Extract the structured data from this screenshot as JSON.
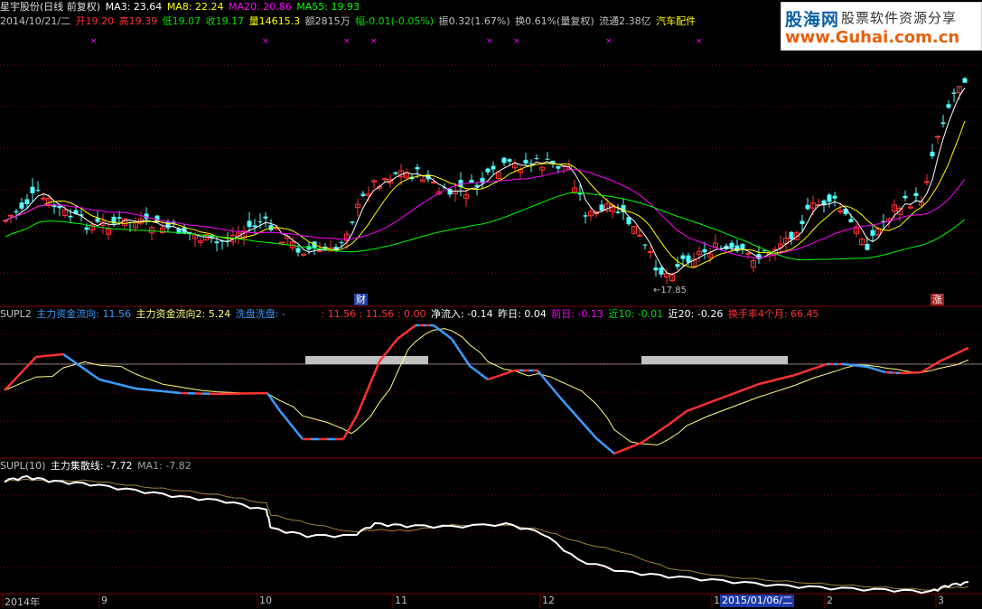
{
  "header": {
    "stock": "星宇股份(日线 前复权)",
    "ma3_label": "MA3: 23.64",
    "ma8_label": "MA8: 22.24",
    "ma20_label": "MA20: 20.86",
    "ma55_label": "MA55: 19.93",
    "date": "2014/10/21/二",
    "open": "开19.20",
    "high": "高19.39",
    "low": "低19.07",
    "close": "收19.17",
    "volume": "量14615.3",
    "amount": "额2815万",
    "change": "幅-0.01(-0.05%)",
    "amplitude": "振0.32(1.67%)",
    "turnover": "换0.61%(量复权)",
    "float": "流通2.38亿",
    "sector": "汽车配件"
  },
  "watermark": {
    "name": "股海网",
    "slogan": "股票软件资源分享",
    "url": "www.Guhai.com.cn"
  },
  "price_panel": {
    "low_label": "17.85",
    "badge_fin": "财",
    "badge_up": "涨"
  },
  "panel2": {
    "title": "SUPL2",
    "flow1": "主力资金流向: 11.56",
    "flow2": "主力资金流向2: 5.24",
    "wash": "洗盘洗盘: -",
    "vals": ": 11.56 : 11.56 : 0.00",
    "net": "净流入: -0.14",
    "yest": "昨日: 0.04",
    "prev": "前日: -0.13",
    "near10": "近10: -0.01",
    "near20": "近20: -0.26",
    "turn4": "换手率4个月: 66.45"
  },
  "panel3": {
    "title": "SUPL(10)",
    "line": "主力集散线: -7.72",
    "ma1": "MA1: -7.82"
  },
  "axis": {
    "labels": [
      "2014年",
      "9",
      "10",
      "11",
      "12",
      "1",
      "2",
      "3"
    ],
    "current_date": "2015/01/06/二"
  },
  "colors": {
    "red": "#ff3232",
    "cyan": "#54ffff",
    "ma3": "#ffffff",
    "ma8": "#ffff00",
    "ma20": "#ff00ff",
    "ma55": "#00ff00",
    "grid": "#800000"
  }
}
